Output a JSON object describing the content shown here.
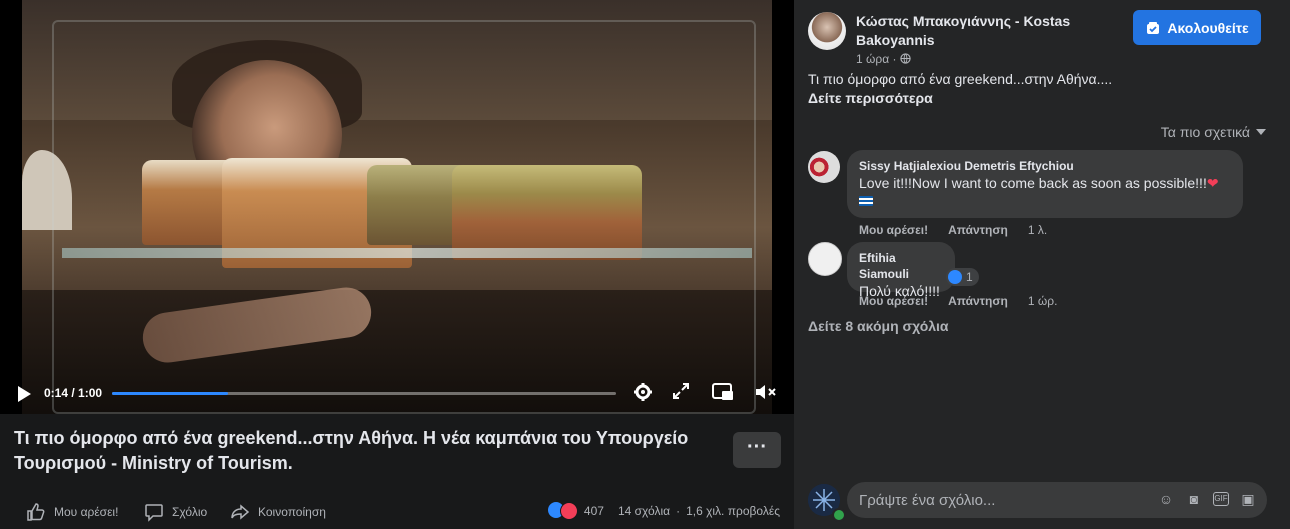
{
  "video": {
    "time": "0:14 / 1:00",
    "progress": 0.23
  },
  "post": {
    "title": "Τι πιο όμορφο από ένα greekend...στην Αθήνα. Η νέα καμπάνια του Υπουργείο Τουρισμού - Ministry of Tourism.",
    "more_label": "···",
    "author": "Κώστας Μπακογιάννης - Kostas Bakoyannis",
    "time": "1 ώρα · ",
    "follow_label": "Ακολουθείτε",
    "text": "Τι πιο όμορφο από ένα greekend...στην Αθήνα....",
    "see_more": "Δείτε περισσότερα"
  },
  "actions": {
    "like": "Μου αρέσει!",
    "comment": "Σχόλιο",
    "share": "Κοινοποίηση",
    "reactions_count": "407",
    "comments_count": "14 σχόλια",
    "views": "1,6 χιλ. προβολές"
  },
  "comments": {
    "sort_label": "Τα πιο σχετικά",
    "items": [
      {
        "name": "Sissy Hatjialexiou Demetris Eftychiou",
        "text": "Love it!!!Now I want to come back as soon as possible!!!",
        "like": "Μου αρέσει!",
        "reply": "Απάντηση",
        "time": "1 λ."
      },
      {
        "name": "Eftihia Siamouli",
        "text": "Πολύ καλό!!!!",
        "reaction_count": "1",
        "like": "Μου αρέσει!",
        "reply": "Απάντηση",
        "time": "1 ώρ."
      }
    ],
    "view_more": "Δείτε 8 ακόμη σχόλια"
  },
  "composer": {
    "placeholder": "Γράψτε ένα σχόλιο..."
  },
  "colors": {
    "accent": "#2374e1",
    "progress": "#2d88ff",
    "love": "#f33e58"
  },
  "icons": [
    "play-icon",
    "settings-icon",
    "fullscreen-icon",
    "pip-icon",
    "volume-muted-icon",
    "like-icon",
    "comment-icon",
    "share-icon",
    "globe-icon",
    "caret-down-icon",
    "emoji-icon",
    "camera-icon",
    "gif-icon",
    "sticker-icon"
  ]
}
